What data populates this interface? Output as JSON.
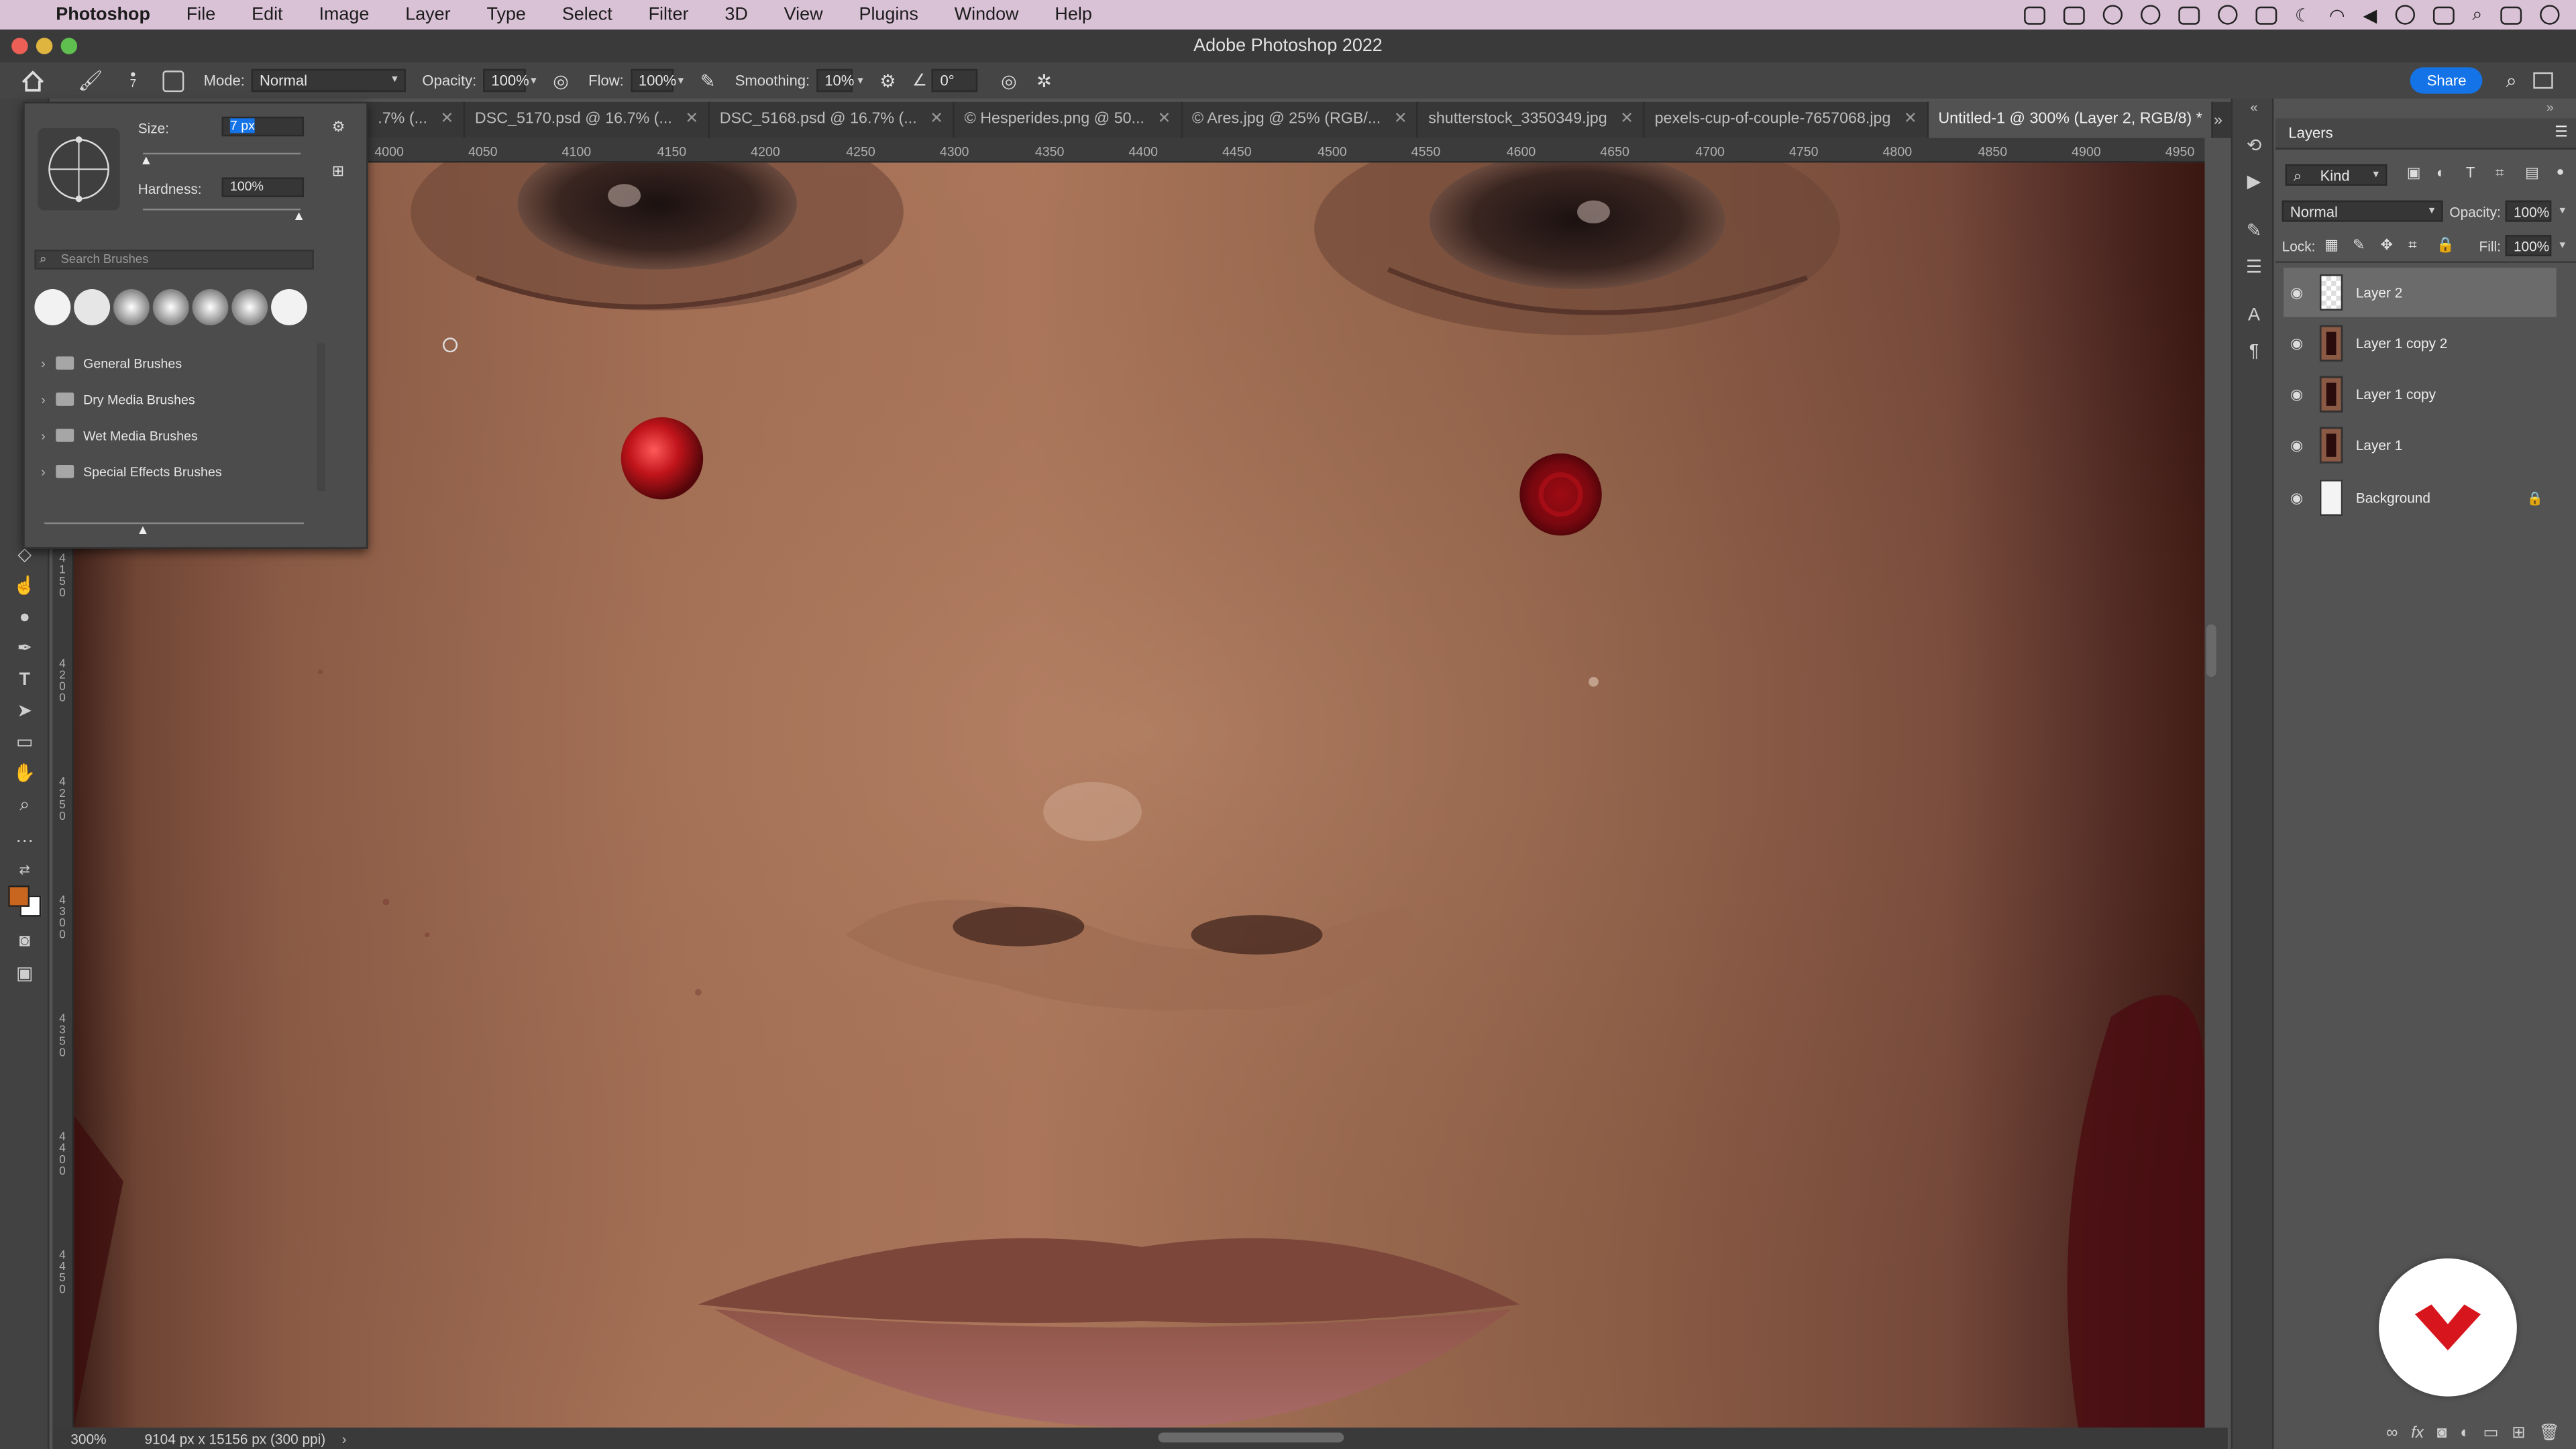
{
  "menubar": {
    "app": "Photoshop",
    "items": [
      "File",
      "Edit",
      "Image",
      "Layer",
      "Type",
      "Select",
      "Filter",
      "3D",
      "View",
      "Plugins",
      "Window",
      "Help"
    ]
  },
  "window": {
    "title": "Adobe Photoshop 2022"
  },
  "options": {
    "brush_size_small": "7",
    "mode_label": "Mode:",
    "mode_value": "Normal",
    "opacity_label": "Opacity:",
    "opacity_value": "100%",
    "flow_label": "Flow:",
    "flow_value": "100%",
    "smoothing_label": "Smoothing:",
    "smoothing_value": "10%",
    "angle_value": "0°",
    "share_label": "Share"
  },
  "tabs": [
    {
      "label": ".7% (..."
    },
    {
      "label": "DSC_5170.psd @ 16.7% (..."
    },
    {
      "label": "DSC_5168.psd @ 16.7% (..."
    },
    {
      "label": "© Hesperides.png @ 50..."
    },
    {
      "label": "© Ares.jpg @ 25% (RGB/..."
    },
    {
      "label": "shutterstock_3350349.jpg"
    },
    {
      "label": "pexels-cup-of-couple-7657068.jpg"
    },
    {
      "label": "Untitled-1 @ 300% (Layer 2, RGB/8) *"
    }
  ],
  "ruler_h": [
    "4000",
    "4050",
    "4100",
    "4150",
    "4200",
    "4250",
    "4300",
    "4350",
    "4400",
    "4450",
    "4500",
    "4550",
    "4600",
    "4650",
    "4700",
    "4750",
    "4800",
    "4850",
    "4900",
    "4950"
  ],
  "ruler_v": [
    "4150",
    "4200",
    "4250",
    "4300",
    "4350",
    "4400",
    "4450"
  ],
  "brush_popover": {
    "size_label": "Size:",
    "size_value": "7 px",
    "hardness_label": "Hardness:",
    "hardness_value": "100%",
    "search_placeholder": "Search Brushes",
    "folders": [
      "General Brushes",
      "Dry Media Brushes",
      "Wet Media Brushes",
      "Special Effects Brushes"
    ]
  },
  "status": {
    "zoom": "300%",
    "doc_info": "9104 px x 15156 px (300 ppi)"
  },
  "layers_panel": {
    "title": "Layers",
    "filter_kind": "Kind",
    "blend_mode": "Normal",
    "opacity_label": "Opacity:",
    "opacity_value": "100%",
    "lock_label": "Lock:",
    "fill_label": "Fill:",
    "fill_value": "100%",
    "layers": [
      {
        "name": "Layer 2",
        "selected": true
      },
      {
        "name": "Layer 1 copy 2",
        "selected": false
      },
      {
        "name": "Layer 1 copy",
        "selected": false
      },
      {
        "name": "Layer 1",
        "selected": false
      },
      {
        "name": "Background",
        "selected": false,
        "locked": true
      }
    ]
  },
  "colors": {
    "foreground": "#c8661f",
    "background": "#ffffff",
    "accent": "#1473e6",
    "brand_red": "#d7151d"
  }
}
